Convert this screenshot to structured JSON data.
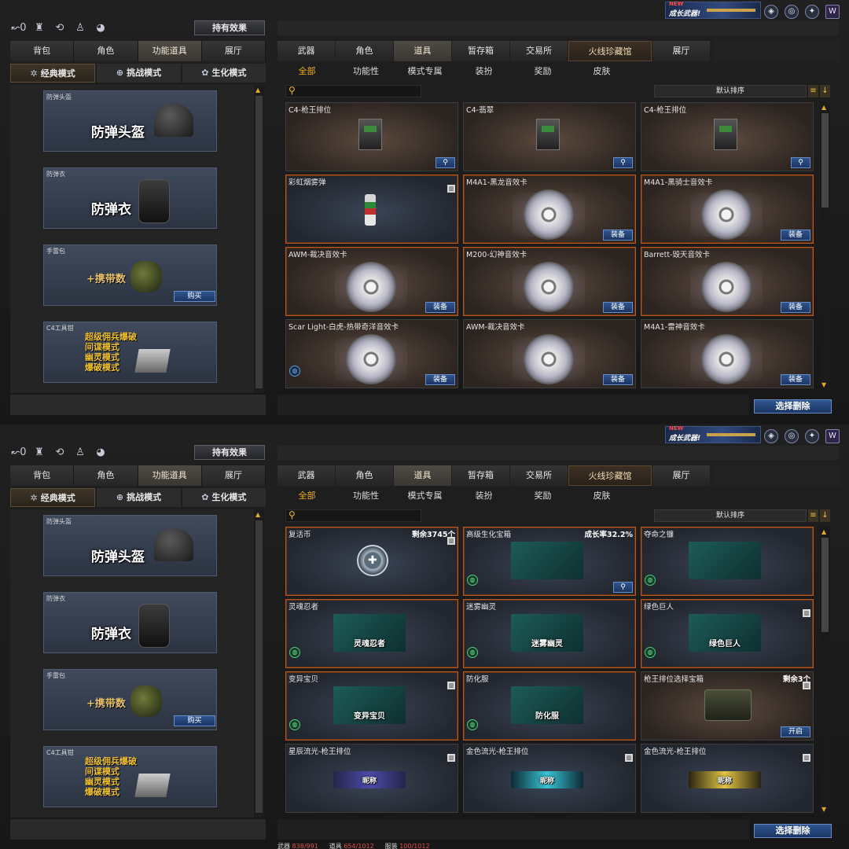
{
  "header": {
    "effect_button": "持有效果",
    "banner_new": "NEW",
    "banner_text": "成长武器!",
    "left_icons": [
      "↜0",
      "trophy-icon",
      "refresh-icon",
      "person-icon",
      "mouse-icon"
    ],
    "right_icons": [
      "shield-icon",
      "target-icon",
      "badge-icon",
      "w-icon"
    ]
  },
  "left": {
    "tabs": [
      "背包",
      "角色",
      "功能道具",
      "展厅"
    ],
    "active_tab": 2,
    "modes": [
      "经典模式",
      "挑战模式",
      "生化模式"
    ],
    "active_mode": 0,
    "cards": {
      "helmet": {
        "label": "防弹头盔",
        "big": "防弹头盔"
      },
      "vest": {
        "label": "防弹衣",
        "big": "防弹衣"
      },
      "grenade": {
        "label": "手雷包",
        "big": "+携带数",
        "button": "购买"
      },
      "c4": {
        "label": "C4工具钳",
        "lines": [
          "超级佣兵爆破",
          "间谍模式",
          "幽灵模式",
          "爆破模式"
        ]
      }
    }
  },
  "right": {
    "tabs": [
      "武器",
      "角色",
      "道具",
      "暂存箱",
      "交易所",
      "火线珍藏馆",
      "展厅"
    ],
    "active_tab": 2,
    "subtabs": [
      "全部",
      "功能性",
      "模式专属",
      "装扮",
      "奖励",
      "皮肤"
    ],
    "active_subtab": 0,
    "sort_label": "默认排序",
    "delete_button": "选择删除"
  },
  "panel1_cards": [
    {
      "title": "C4-枪王排位",
      "type": "c4",
      "button": "🔍"
    },
    {
      "title": "C4-翡翠",
      "type": "c4",
      "button": "🔍"
    },
    {
      "title": "C4-枪王排位",
      "type": "c4",
      "button": "🔍"
    },
    {
      "title": "彩虹烟雾弹",
      "type": "smoke"
    },
    {
      "title": "M4A1-黑龙音效卡",
      "type": "disc",
      "button": "装备"
    },
    {
      "title": "M4A1-黑骑士音效卡",
      "type": "disc",
      "button": "装备"
    },
    {
      "title": "AWM-裁决音效卡",
      "type": "disc",
      "button": "装备"
    },
    {
      "title": "M200-幻神音效卡",
      "type": "disc",
      "button": "装备"
    },
    {
      "title": "Barrett-毁天音效卡",
      "type": "disc",
      "button": "装备"
    },
    {
      "title": "Scar Light-白虎-热带奇洋音效卡",
      "type": "disc",
      "button": "装备"
    },
    {
      "title": "AWM-裁决音效卡",
      "type": "disc",
      "button": "装备"
    },
    {
      "title": "M4A1-雷神音效卡",
      "type": "disc",
      "button": "装备"
    }
  ],
  "panel2_cards": [
    {
      "title": "复活币",
      "extra": "剩余3745个",
      "type": "coin"
    },
    {
      "title": "高级生化宝箱",
      "extra": "成长率32.2%",
      "type": "pic",
      "pic_text": "",
      "button": "🔍"
    },
    {
      "title": "夺命之镰",
      "type": "pic",
      "pic_text": ""
    },
    {
      "title": "灵魂忍者",
      "type": "pic",
      "pic_text": "灵魂忍者"
    },
    {
      "title": "迷雾幽灵",
      "type": "pic",
      "pic_text": "迷雾幽灵"
    },
    {
      "title": "绿色巨人",
      "type": "pic",
      "pic_text": "绿色巨人"
    },
    {
      "title": "变异宝贝",
      "type": "pic",
      "pic_text": "变异宝贝"
    },
    {
      "title": "防化服",
      "type": "pic",
      "pic_text": "防化服"
    },
    {
      "title": "枪王排位选择宝箱",
      "extra": "剩余3个",
      "type": "crate",
      "button": "开启"
    },
    {
      "title": "星辰流光-枪王排位",
      "type": "name-purple",
      "pic_text": "昵称"
    },
    {
      "title": "金色流光-枪王排位",
      "type": "name-cyan",
      "pic_text": "昵称"
    },
    {
      "title": "金色流光-枪王排位",
      "type": "name-gold",
      "pic_text": "昵称"
    }
  ],
  "footer_stats": [
    {
      "label": "武器",
      "value": "838/991"
    },
    {
      "label": "道具",
      "value": "654/1012"
    },
    {
      "label": "服装",
      "value": "100/1012"
    }
  ]
}
